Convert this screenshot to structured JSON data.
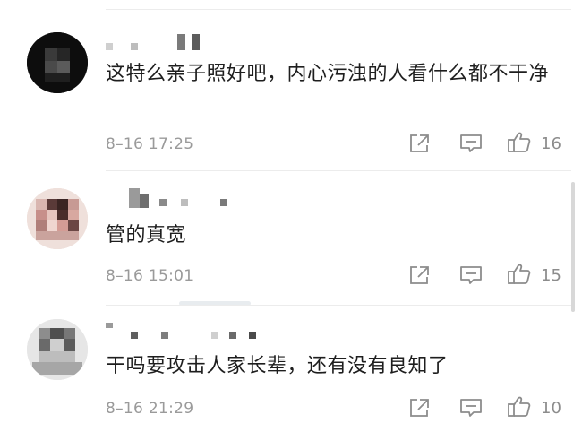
{
  "comments": [
    {
      "text": "这特么亲子照好吧，内心污浊的人看什么都不干净",
      "time": "8–16 17:25",
      "likes": "16"
    },
    {
      "text": "管的真宽",
      "time": "8–16 15:01",
      "likes": "15"
    },
    {
      "text": "干吗要攻击人家长辈，还有没有良知了",
      "time": "8–16 21:29",
      "likes": "10"
    }
  ],
  "icons": {
    "share": "share-icon",
    "reply": "comment-icon",
    "like": "thumbs-up-icon"
  },
  "colors": {
    "text": "#1e1e1e",
    "meta": "#9a9a9a",
    "icon": "#8c8c8c",
    "divider": "#ececec"
  }
}
